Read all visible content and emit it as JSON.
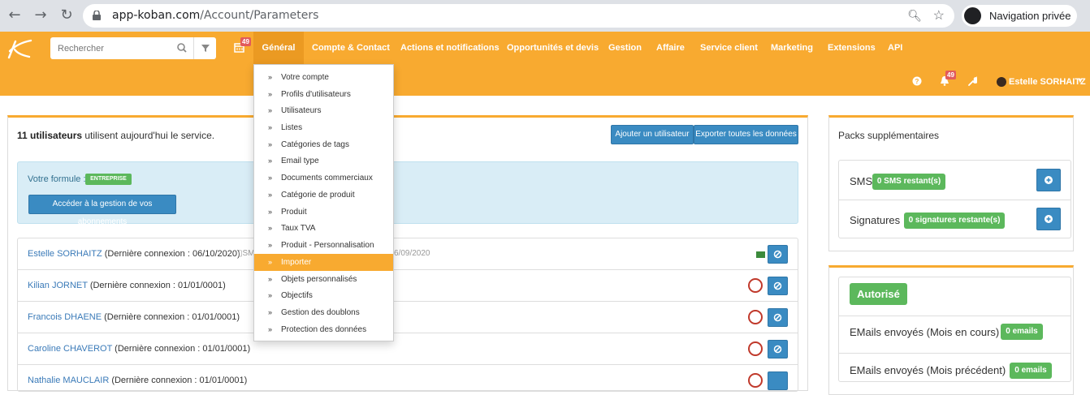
{
  "browser": {
    "url_host": "app-koban.com",
    "url_path": "/Account/Parameters",
    "private_label": "Navigation privée"
  },
  "header": {
    "search_placeholder": "Rechercher",
    "calendar_badge": "49",
    "menu": [
      "Général",
      "Compte & Contact",
      "Actions et notifications",
      "Opportunités et devis",
      "Gestion",
      "Affaire",
      "Service client",
      "Marketing",
      "Extensions",
      "API"
    ],
    "bell_badge": "49",
    "user_name": "Estelle SORHAITZ"
  },
  "dropdown": {
    "items": [
      "Votre compte",
      "Profils d'utilisateurs",
      "Utilisateurs",
      "Listes",
      "Catégories de tags",
      "Email type",
      "Documents commerciaux",
      "Catégorie de produit",
      "Produit",
      "Taux TVA",
      "Produit - Personnalisation",
      "Importer",
      "Objets personnalisés",
      "Objectifs",
      "Gestion des doublons",
      "Protection des données"
    ],
    "active_index": 11
  },
  "main": {
    "summary_bold": "11 utilisateurs",
    "summary_rest": " utilisent aujourd'hui le service.",
    "add_user_label": "Ajouter un utilisateur",
    "export_label": "Exporter toutes les données",
    "formule_label": "Votre formule :",
    "formule_badge": "ENTREPRISE",
    "subscriptions_label": "Accéder à la gestion de vos abonnements",
    "users": [
      {
        "name": "Estelle SORHAITZ",
        "detail": " (Dernière connexion : 06/10/2020)"
      },
      {
        "name": "Kilian JORNET",
        "detail": " (Dernière connexion : 01/01/0001)"
      },
      {
        "name": "Francois DHAENE",
        "detail": " (Dernière connexion : 01/01/0001)"
      },
      {
        "name": "Caroline CHAVEROT",
        "detail": " (Dernière connexion : 01/01/0001)"
      },
      {
        "name": "Nathalie MAUCLAIR",
        "detail": " (Dernière connexion : 01/01/0001)"
      }
    ],
    "row0_sms_note": "SM",
    "row0_date_note": "6/09/2020"
  },
  "side": {
    "title": "Packs supplémentaires",
    "sms_label": "SMS",
    "sms_badge": "0 SMS restant(s)",
    "signatures_label": "Signatures",
    "signatures_badge": "0 signatures restante(s)",
    "autorise_label": "Autorisé",
    "emails_current_label": "EMails envoyés (Mois en cours)",
    "emails_current_badge": "0 emails",
    "emails_prev_label": "EMails envoyés (Mois précédent)",
    "emails_prev_badge": "0 emails"
  },
  "colors": {
    "brand_orange": "#f8aa30",
    "menu_active": "#eb9a22",
    "primary_blue": "#3a8bc2",
    "success_green": "#5cb85c",
    "danger_red": "#e25b5b"
  }
}
